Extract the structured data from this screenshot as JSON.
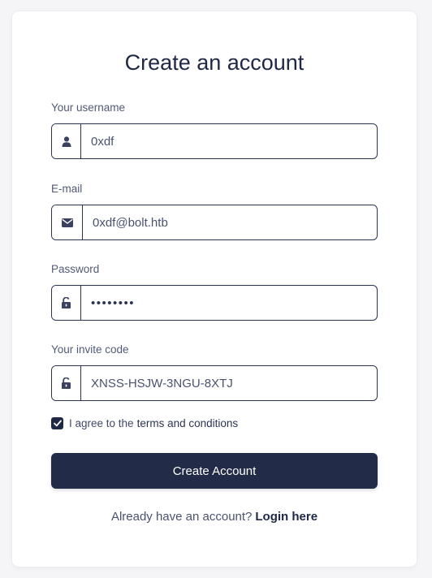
{
  "form": {
    "title": "Create an account",
    "username": {
      "label": "Your username",
      "value": "0xdf",
      "icon": "user-icon"
    },
    "email": {
      "label": "E-mail",
      "value": "0xdf@bolt.htb",
      "icon": "envelope-icon"
    },
    "password": {
      "label": "Password",
      "value": "••••••••",
      "icon": "unlock-icon"
    },
    "invite": {
      "label": "Your invite code",
      "value": "XNSS-HSJW-3NGU-8XTJ",
      "icon": "unlock-icon"
    },
    "terms": {
      "checked": true,
      "prefix": "I agree to the",
      "link": "terms and conditions"
    },
    "submit_label": "Create Account",
    "footer": {
      "text": "Already have an account?",
      "link": "Login here"
    }
  },
  "colors": {
    "primary": "#222b48",
    "text": "#2b3352",
    "background": "#f5f5f7"
  }
}
